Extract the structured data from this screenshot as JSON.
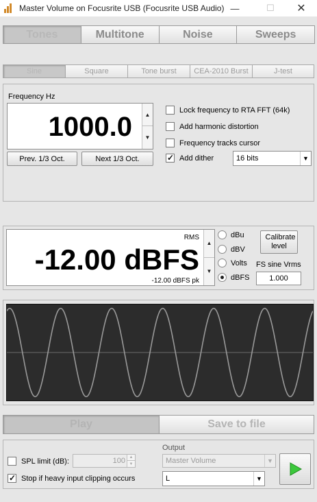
{
  "window": {
    "title": "Master Volume on Focusrite USB (Focusrite USB Audio)"
  },
  "tabs": [
    {
      "label": "Tones",
      "active": true
    },
    {
      "label": "Multitone",
      "active": false
    },
    {
      "label": "Noise",
      "active": false
    },
    {
      "label": "Sweeps",
      "active": false
    }
  ],
  "subtabs": [
    {
      "label": "Sine",
      "active": true
    },
    {
      "label": "Square",
      "active": false
    },
    {
      "label": "Tone burst",
      "active": false
    },
    {
      "label": "CEA-2010 Burst",
      "active": false
    },
    {
      "label": "J-test",
      "active": false
    }
  ],
  "frequency": {
    "label": "Frequency Hz",
    "value": "1000.0",
    "prev_label": "Prev. 1/3 Oct.",
    "next_label": "Next 1/3 Oct."
  },
  "options": {
    "lock_fft": {
      "label": "Lock frequency to RTA FFT (64k)",
      "checked": false
    },
    "harmonic": {
      "label": "Add harmonic distortion",
      "checked": false
    },
    "tracks_cursor": {
      "label": "Frequency tracks cursor",
      "checked": false
    },
    "dither": {
      "label": "Add dither",
      "checked": true,
      "bits": "16 bits"
    }
  },
  "level": {
    "rms_label": "RMS",
    "value": "-12.00 dBFS",
    "peak": "-12.00 dBFS pk",
    "units": [
      {
        "label": "dBu",
        "selected": false
      },
      {
        "label": "dBV",
        "selected": false
      },
      {
        "label": "Volts",
        "selected": false
      },
      {
        "label": "dBFS",
        "selected": true
      }
    ],
    "calibrate_label": "Calibrate level",
    "fs_label": "FS sine Vrms",
    "fs_value": "1.000"
  },
  "actions": {
    "play_label": "Play",
    "save_label": "Save to file"
  },
  "bottom": {
    "spl_label": "SPL limit (dB):",
    "spl_checked": false,
    "spl_value": "100",
    "clip_label": "Stop if heavy input clipping occurs",
    "clip_checked": true,
    "output_label": "Output",
    "output_device": "Master Volume",
    "output_channel": "L"
  },
  "colors": {
    "scope_background": "#2c2c2c",
    "waveform": "#9a9a9a",
    "axis": "#6a6a6a",
    "play_icon": "#3cc83c"
  },
  "waveform": {
    "cycles": 6,
    "amplitude_fraction": 0.5
  }
}
